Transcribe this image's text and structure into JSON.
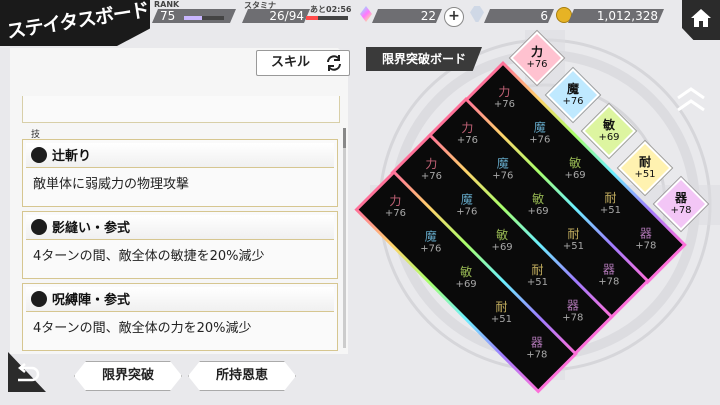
{
  "header": {
    "title": "ステイタスボード",
    "rank_label": "RANK",
    "rank_value": "75",
    "stamina_label": "スタミナ",
    "stamina_value": "26/94",
    "stamina_timer": "あと02:56",
    "gems_value": "22",
    "items_value": "6",
    "coins_value": "1,012,328"
  },
  "skill_tab": {
    "label": "スキル"
  },
  "skills_section": {
    "label": "技",
    "items": [
      {
        "name": "辻斬り",
        "desc": "敵単体に弱威力の物理攻撃"
      },
      {
        "name": "影縫い・参式",
        "desc": "4ターンの間、敵全体の敏捷を20%減少"
      },
      {
        "name": "呪縛陣・参式",
        "desc": "4ターンの間、敵全体の力を20%減少"
      }
    ]
  },
  "bottom_buttons": {
    "limit_break": "限界突破",
    "blessings": "所持恩恵"
  },
  "board": {
    "title": "限界突破ボード",
    "tiles": [
      {
        "k": "力",
        "v": "+76",
        "color": "#ffc2d0"
      },
      {
        "k": "魔",
        "v": "+76",
        "color": "#bfe9ff"
      },
      {
        "k": "敏",
        "v": "+69",
        "color": "#ddf5a0"
      },
      {
        "k": "耐",
        "v": "+51",
        "color": "#fff2b0"
      },
      {
        "k": "器",
        "v": "+78",
        "color": "#f3c6f6"
      }
    ],
    "rows": [
      [
        {
          "k": "力",
          "v": "+76"
        },
        {
          "k": "魔",
          "v": "+76"
        },
        {
          "k": "敏",
          "v": "+69"
        },
        {
          "k": "耐",
          "v": "+51"
        },
        {
          "k": "器",
          "v": "+78"
        }
      ],
      [
        {
          "k": "力",
          "v": "+76"
        },
        {
          "k": "魔",
          "v": "+76"
        },
        {
          "k": "敏",
          "v": "+69"
        },
        {
          "k": "耐",
          "v": "+51"
        },
        {
          "k": "器",
          "v": "+78"
        }
      ],
      [
        {
          "k": "力",
          "v": "+76"
        },
        {
          "k": "魔",
          "v": "+76"
        },
        {
          "k": "敏",
          "v": "+69"
        },
        {
          "k": "耐",
          "v": "+51"
        },
        {
          "k": "器",
          "v": "+78"
        }
      ],
      [
        {
          "k": "力",
          "v": "+76"
        },
        {
          "k": "魔",
          "v": "+76"
        },
        {
          "k": "敏",
          "v": "+69"
        },
        {
          "k": "耐",
          "v": "+51"
        },
        {
          "k": "器",
          "v": "+78"
        }
      ]
    ]
  },
  "colors": {
    "力": "#ff7f9a",
    "魔": "#7fd7ff",
    "敏": "#c6f26b",
    "耐": "#ffe37a",
    "器": "#e89cf0"
  }
}
